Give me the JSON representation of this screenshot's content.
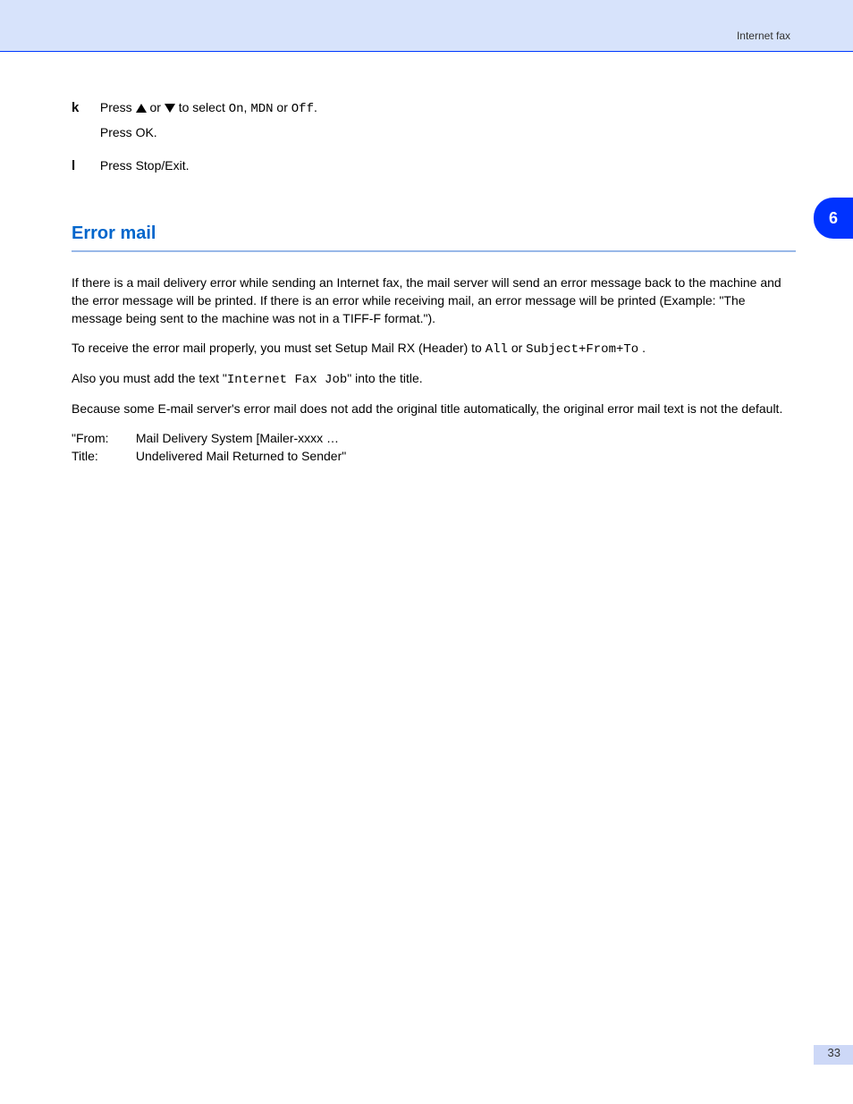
{
  "header": {
    "text": "Internet fax"
  },
  "sideTab": {
    "label": "6"
  },
  "items": {
    "k": {
      "label": "k",
      "line1_prefix": "Press ",
      "line1_mid": " or ",
      "line1_select": " to select ",
      "opt_on": "On",
      "comma1": ", ",
      "opt_mdn": "MDN",
      "or2": " or ",
      "opt_off": "Off",
      "period": ".",
      "line2": "Press OK."
    },
    "l": {
      "label": "l",
      "line": "Press Stop/Exit."
    }
  },
  "section": {
    "title": "Error mail",
    "p1": "If there is a mail delivery error while sending an Internet fax, the mail server will send an error message back to the machine and the error message will be printed. If there is an error while receiving mail, an error message will be printed (Example: \"The message being sent to the machine was not in a TIFF-F format.\").",
    "p2_prefix": "To receive the error mail properly, you must set Setup Mail RX (Header) to ",
    "p2_mono1": "All",
    "p2_mid": " or ",
    "p2_mono2": "Subject+From+To",
    "p2_period": ".",
    "p3_prefix": "Also you must add the text \"",
    "p3_mono": "Internet Fax Job",
    "p3_suffix": "\" into the title.",
    "p4": "Because some E-mail server's error mail does not add the original title automatically, the original error mail text is not the default.",
    "mail": {
      "fromLabel": "\"From:",
      "fromValue": "Mail Delivery System [Mailer-xxxx …",
      "titleLabel": "Title:",
      "titleValue": "Undelivered Mail Returned to Sender\""
    }
  },
  "footer": {
    "page": "33"
  }
}
